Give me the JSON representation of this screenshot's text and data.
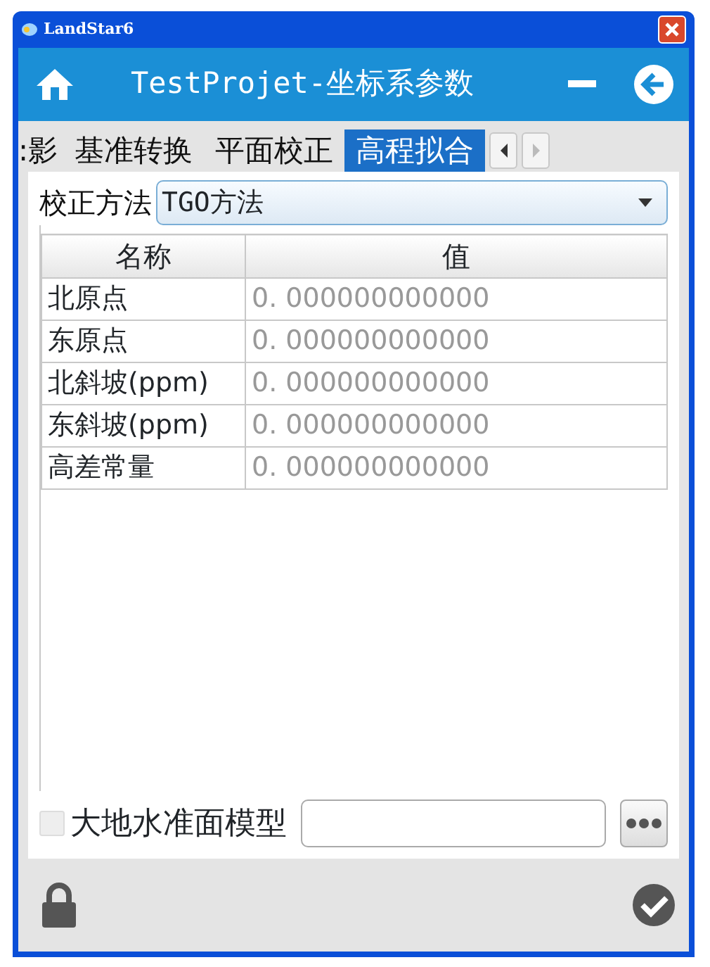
{
  "window": {
    "title": "LandStar6"
  },
  "header": {
    "title": "TestProjet-坐标系参数"
  },
  "tabs": [
    {
      "label": ":影",
      "selected": false
    },
    {
      "label": "基准转换",
      "selected": false
    },
    {
      "label": "平面校正",
      "selected": false
    },
    {
      "label": "高程拟合",
      "selected": true
    }
  ],
  "method": {
    "label": "校正方法",
    "value": "TGO方法"
  },
  "table": {
    "columns": [
      "名称",
      "值"
    ],
    "rows": [
      [
        "北原点",
        "0. 000000000000"
      ],
      [
        "东原点",
        "0. 000000000000"
      ],
      [
        "北斜坡(ppm)",
        "0. 000000000000"
      ],
      [
        "东斜坡(ppm)",
        "0. 000000000000"
      ],
      [
        "高差常量",
        "0. 000000000000"
      ]
    ]
  },
  "geoid": {
    "label": "大地水准面模型",
    "checked": false
  }
}
